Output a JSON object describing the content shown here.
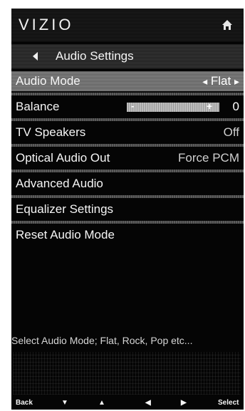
{
  "header": {
    "logo": "VIZIO",
    "home_icon": "home-icon"
  },
  "breadcrumb": {
    "title": "Audio Settings",
    "back_icon": "left-arrow-icon"
  },
  "menu": {
    "items": [
      {
        "label": "Audio Mode",
        "value": "Flat",
        "selected": true
      },
      {
        "label": "Balance",
        "value": "0"
      },
      {
        "label": "TV Speakers",
        "value": "Off"
      },
      {
        "label": "Optical Audio Out",
        "value": "Force PCM"
      },
      {
        "label": "Advanced Audio"
      },
      {
        "label": "Equalizer Settings"
      },
      {
        "label": "Reset Audio Mode"
      }
    ],
    "balance_minus": "-",
    "balance_plus": "+"
  },
  "hint": "Select Audio Mode; Flat, Rock, Pop etc...",
  "controls": {
    "back": "Back",
    "select": "Select"
  },
  "colors": {
    "panel_bg": "#050505",
    "text": "#f5f5f5",
    "highlight": "#6f6f6f"
  }
}
